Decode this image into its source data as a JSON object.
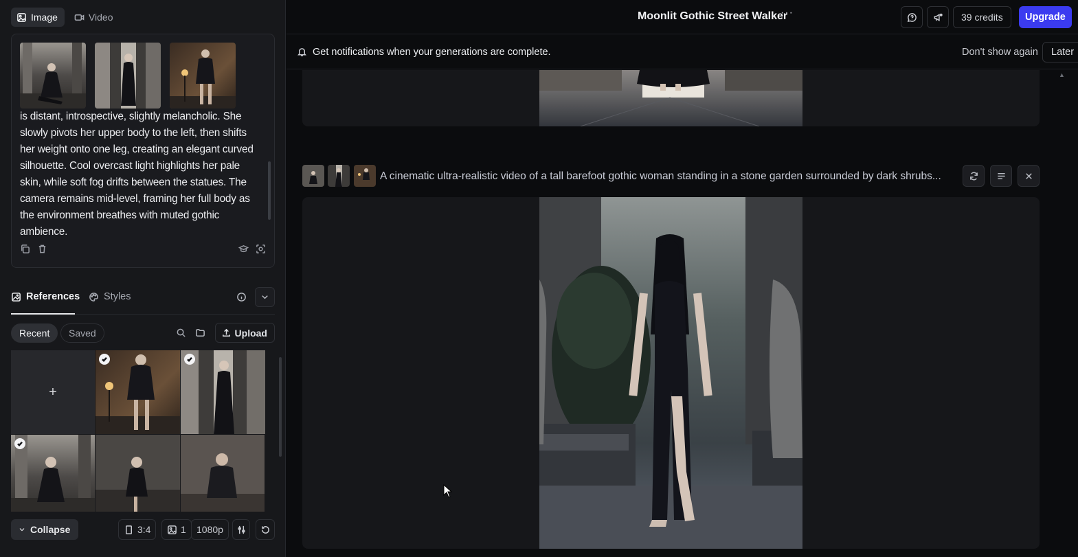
{
  "mode_tabs": [
    {
      "label": "Image",
      "icon": "image-icon",
      "active": true
    },
    {
      "label": "Video",
      "icon": "video-icon",
      "active": false
    }
  ],
  "prompt_card": {
    "text": "is distant, introspective, slightly melancholic. She slowly pivots her upper body to the left, then shifts her weight onto one leg, creating an elegant curved silhouette. Cool overcast light highlights her pale skin, while soft fog drifts between the statues. The camera remains mid-level, framing her full body as the environment breathes with muted gothic ambience."
  },
  "references": {
    "tabs": [
      {
        "label": "References",
        "icon": "references-icon",
        "active": true
      },
      {
        "label": "Styles",
        "icon": "palette-icon",
        "active": false
      }
    ],
    "filters": [
      {
        "label": "Recent",
        "active": true
      },
      {
        "label": "Saved",
        "active": false
      }
    ],
    "upload_label": "Upload",
    "add_label": "+"
  },
  "bottom_bar": {
    "collapse_label": "Collapse",
    "aspect_ratio": "3:4",
    "image_count": "1",
    "resolution": "1080p"
  },
  "header": {
    "title": "Moonlit Gothic Street Walker",
    "more": "···",
    "credits": "39 credits",
    "upgrade": "Upgrade"
  },
  "notification": {
    "message": "Get notifications when your generations are complete.",
    "dont_show": "Don't show again",
    "later": "Later"
  },
  "generation": {
    "prompt": "A cinematic ultra-realistic video of a tall barefoot gothic woman standing in a stone garden surrounded by dark shrubs..."
  },
  "colors": {
    "accent": "#3b3bf0",
    "panel": "#17181b",
    "background": "#0b0c0e"
  }
}
